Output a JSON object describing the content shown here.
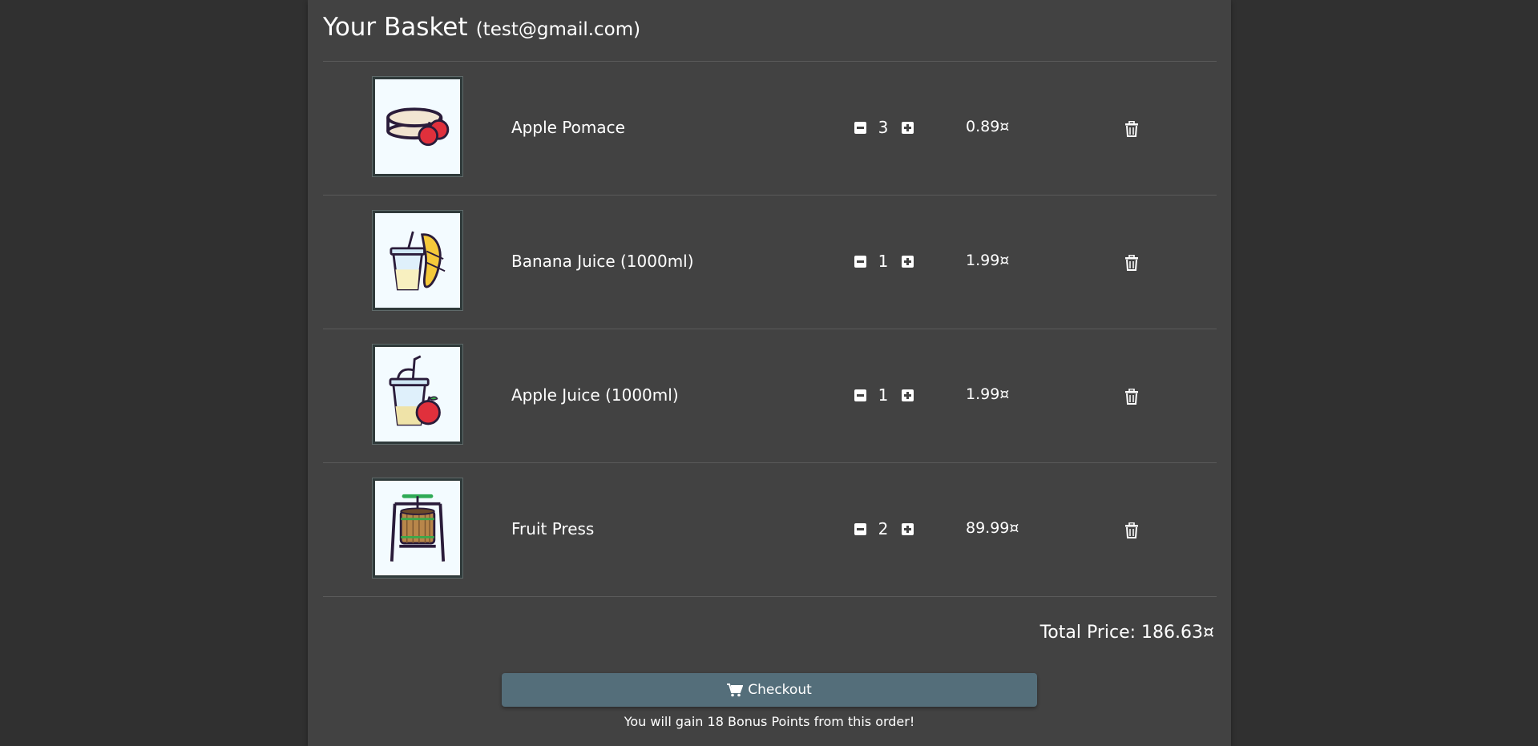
{
  "basket": {
    "title": "Your Basket",
    "email": "(test@gmail.com)"
  },
  "items": [
    {
      "name": "Apple Pomace",
      "quantity": "3",
      "price": "0.89¤",
      "image_icon": "apple-pomace-icon"
    },
    {
      "name": "Banana Juice (1000ml)",
      "quantity": "1",
      "price": "1.99¤",
      "image_icon": "banana-juice-icon"
    },
    {
      "name": "Apple Juice (1000ml)",
      "quantity": "1",
      "price": "1.99¤",
      "image_icon": "apple-juice-icon"
    },
    {
      "name": "Fruit Press",
      "quantity": "2",
      "price": "89.99¤",
      "image_icon": "fruit-press-icon"
    }
  ],
  "summary": {
    "total": "Total Price: 186.63¤",
    "checkout_label": "Checkout",
    "bonus_text": "You will gain 18 Bonus Points from this order!"
  },
  "colors": {
    "page_bg": "#303030",
    "card_bg": "#424242",
    "button_bg": "#546e7a"
  }
}
